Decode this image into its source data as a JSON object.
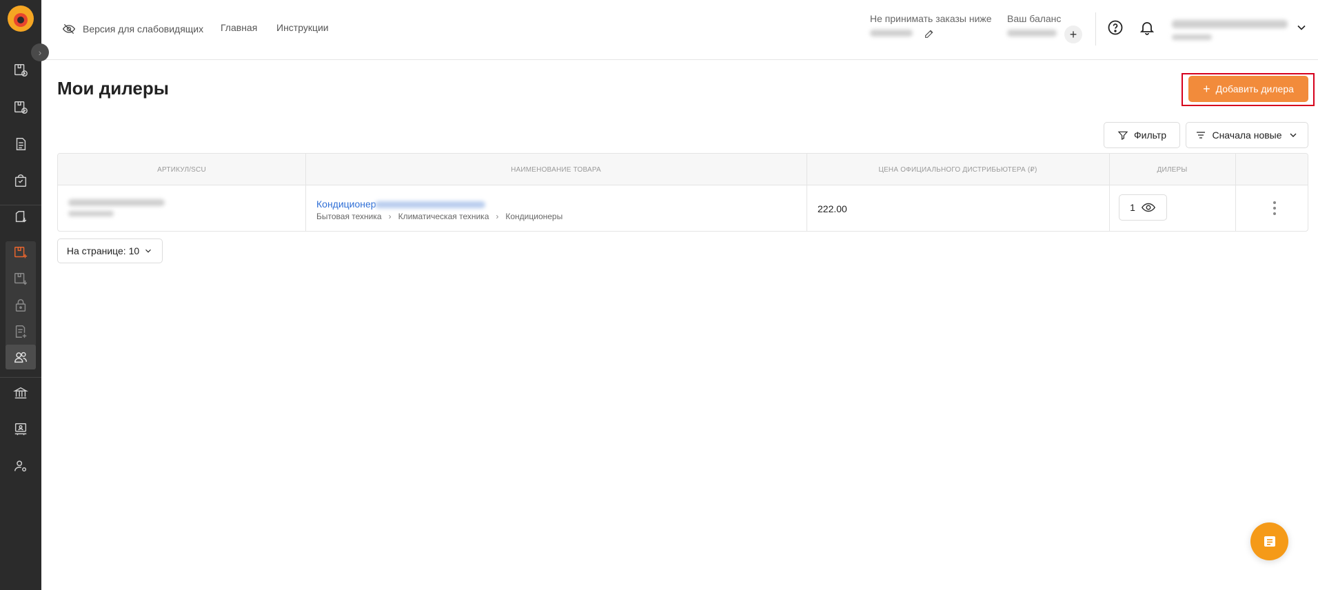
{
  "header": {
    "low_vision": "Версия для слабовидящих",
    "home": "Главная",
    "instructions": "Инструкции",
    "min_order_label": "Не принимать заказы ниже",
    "balance_label": "Ваш баланс",
    "plus": "+"
  },
  "page": {
    "title": "Мои дилеры",
    "add_button": "Добавить дилера",
    "filter": "Фильтр",
    "sort": "Сначала новые"
  },
  "table": {
    "headers": [
      "Артикул/SCU",
      "Наименование товара",
      "Цена официального дистрибьютера (₽)",
      "Дилеры"
    ],
    "rows": [
      {
        "name": "Кондиционер",
        "breadcrumbs": [
          "Бытовая техника",
          "Климатическая техника",
          "Кондиционеры"
        ],
        "price": "222.00",
        "dealers_count": "1"
      }
    ]
  },
  "pagination": {
    "per_page": "На странице: 10"
  },
  "colors": {
    "accent": "#f28b3b",
    "sidebar_bg": "#2b2b2b",
    "link": "#2f6fd6",
    "highlight": "#d6001c"
  }
}
